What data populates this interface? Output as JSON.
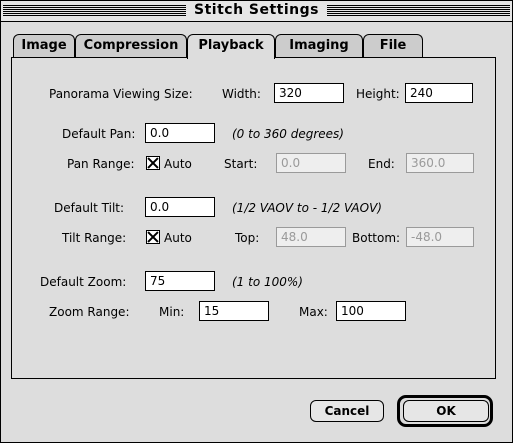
{
  "window": {
    "title": "Stitch Settings"
  },
  "tabs": [
    {
      "label": "Image"
    },
    {
      "label": "Compression"
    },
    {
      "label": "Playback"
    },
    {
      "label": "Imaging"
    },
    {
      "label": "File"
    }
  ],
  "playback": {
    "viewing_size_label": "Panorama Viewing Size:",
    "width_label": "Width:",
    "width_value": "320",
    "height_label": "Height:",
    "height_value": "240",
    "default_pan_label": "Default Pan:",
    "default_pan_value": "0.0",
    "default_pan_hint": "(0 to 360 degrees)",
    "pan_range_label": "Pan Range:",
    "pan_auto_label": "Auto",
    "pan_start_label": "Start:",
    "pan_start_value": "0.0",
    "pan_end_label": "End:",
    "pan_end_value": "360.0",
    "default_tilt_label": "Default Tilt:",
    "default_tilt_value": "0.0",
    "default_tilt_hint": "(1/2 VAOV to - 1/2 VAOV)",
    "tilt_range_label": "Tilt Range:",
    "tilt_auto_label": "Auto",
    "tilt_top_label": "Top:",
    "tilt_top_value": "48.0",
    "tilt_bottom_label": "Bottom:",
    "tilt_bottom_value": "-48.0",
    "default_zoom_label": "Default Zoom:",
    "default_zoom_value": "75",
    "default_zoom_hint": "(1 to 100%)",
    "zoom_range_label": "Zoom Range:",
    "zoom_min_label": "Min:",
    "zoom_min_value": "15",
    "zoom_max_label": "Max:",
    "zoom_max_value": "100"
  },
  "buttons": {
    "cancel": "Cancel",
    "ok": "OK"
  }
}
